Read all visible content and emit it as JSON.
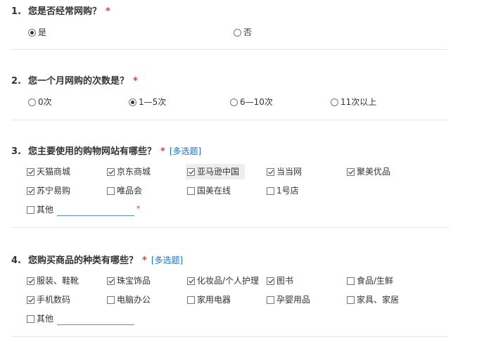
{
  "colors": {
    "required": "#e4393c",
    "link": "#1a6fc7",
    "divider": "#e6e6e6"
  },
  "q1": {
    "num": "1.",
    "title": "您是否经常网购？",
    "required": "*",
    "options": [
      {
        "label": "是",
        "checked": true
      },
      {
        "label": "否",
        "checked": false
      }
    ]
  },
  "q2": {
    "num": "2.",
    "title": "您一个月网购的次数是？",
    "required": "*",
    "options": [
      {
        "label": "0次",
        "checked": false
      },
      {
        "label": "1—5次",
        "checked": true
      },
      {
        "label": "6—10次",
        "checked": false
      },
      {
        "label": "11次以上",
        "checked": false
      }
    ]
  },
  "q3": {
    "num": "3.",
    "title": "您主要使用的购物网站有哪些？",
    "required": "*",
    "multi": "[多选题]",
    "options": [
      {
        "label": "天猫商城",
        "checked": true
      },
      {
        "label": "京东商城",
        "checked": true
      },
      {
        "label": "亚马逊中国",
        "checked": true
      },
      {
        "label": "当当网",
        "checked": true
      },
      {
        "label": "聚美优品",
        "checked": true
      },
      {
        "label": "苏宁易购",
        "checked": true
      },
      {
        "label": "唯品会",
        "checked": false
      },
      {
        "label": "国美在线",
        "checked": false
      },
      {
        "label": "1号店",
        "checked": false
      },
      {
        "label": "其他",
        "checked": false
      }
    ],
    "other_required": "*"
  },
  "q4": {
    "num": "4.",
    "title": "您购买商品的种类有哪些？",
    "required": "*",
    "multi": "[多选题]",
    "options": [
      {
        "label": "服装、鞋靴",
        "checked": true
      },
      {
        "label": "珠宝饰品",
        "checked": true
      },
      {
        "label": "化妆品/个人护理",
        "checked": true
      },
      {
        "label": "图书",
        "checked": true
      },
      {
        "label": "食品/生鲜",
        "checked": false
      },
      {
        "label": "手机数码",
        "checked": true
      },
      {
        "label": "电脑办公",
        "checked": false
      },
      {
        "label": "家用电器",
        "checked": false
      },
      {
        "label": "孕婴用品",
        "checked": false
      },
      {
        "label": "家具、家居",
        "checked": false
      },
      {
        "label": "其他",
        "checked": false
      }
    ]
  }
}
